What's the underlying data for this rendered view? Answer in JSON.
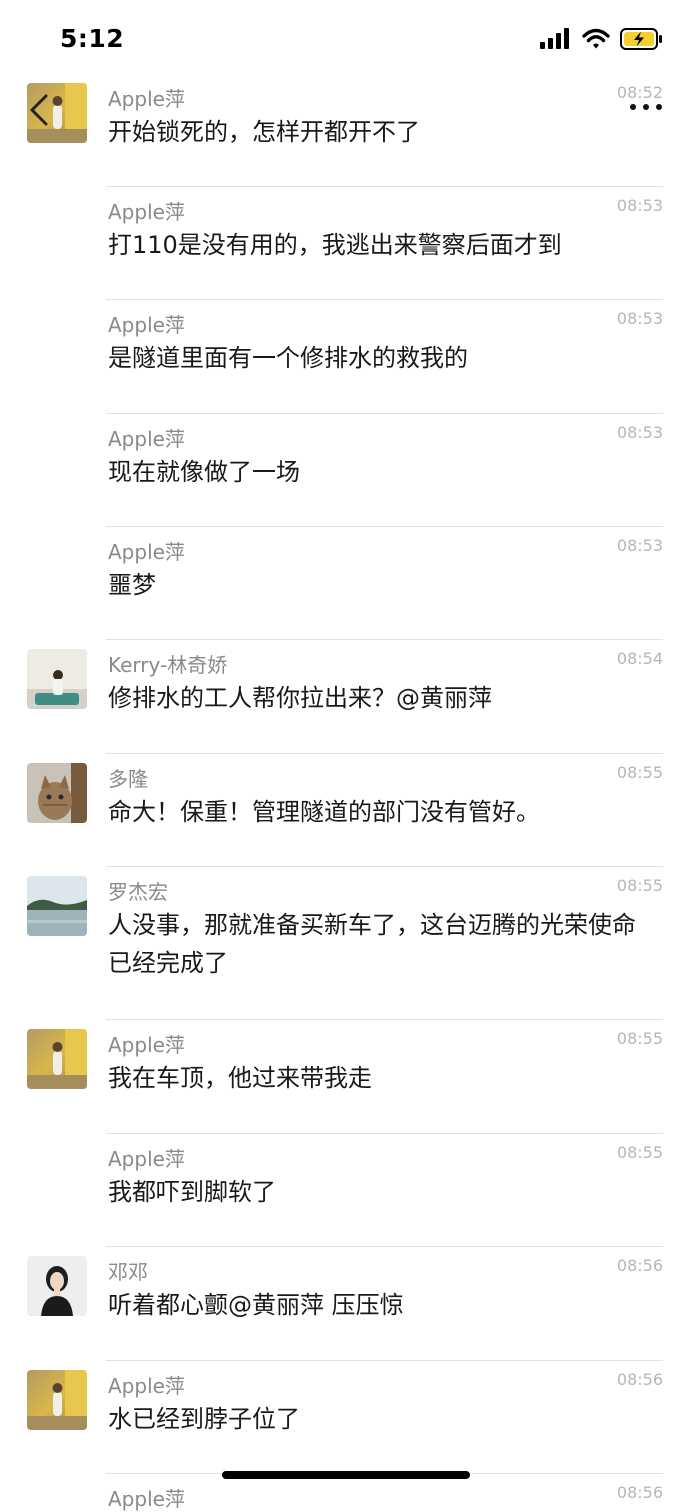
{
  "status_bar": {
    "time": "5:12"
  },
  "messages": [
    {
      "sender": "Apple萍",
      "time": "08:52",
      "text": "开始锁死的，怎样开都开不了",
      "avatar": "avatar-apple"
    },
    {
      "sender": "Apple萍",
      "time": "08:53",
      "text": "打110是没有用的，我逃出来警察后面才到",
      "avatar": ""
    },
    {
      "sender": "Apple萍",
      "time": "08:53",
      "text": "是隧道里面有一个修排水的救我的",
      "avatar": ""
    },
    {
      "sender": "Apple萍",
      "time": "08:53",
      "text": "现在就像做了一场",
      "avatar": ""
    },
    {
      "sender": "Apple萍",
      "time": "08:53",
      "text": "噩梦",
      "avatar": ""
    },
    {
      "sender": "Kerry-林奇娇",
      "time": "08:54",
      "text": "修排水的工人帮你拉出来？@黄丽萍",
      "avatar": "avatar-kerry"
    },
    {
      "sender": "多隆",
      "time": "08:55",
      "text": "命大！保重！管理隧道的部门没有管好。",
      "avatar": "avatar-cat"
    },
    {
      "sender": "罗杰宏",
      "time": "08:55",
      "text": "人没事，那就准备买新车了，这台迈腾的光荣使命已经完成了",
      "avatar": "avatar-lake"
    },
    {
      "sender": "Apple萍",
      "time": "08:55",
      "text": "我在车顶，他过来带我走",
      "avatar": "avatar-apple"
    },
    {
      "sender": "Apple萍",
      "time": "08:55",
      "text": "我都吓到脚软了",
      "avatar": ""
    },
    {
      "sender": "邓邓",
      "time": "08:56",
      "text": "听着都心颤@黄丽萍 压压惊",
      "avatar": "avatar-woman"
    },
    {
      "sender": "Apple萍",
      "time": "08:56",
      "text": "水已经到脖子位了",
      "avatar": "avatar-apple"
    },
    {
      "sender": "Apple萍",
      "time": "08:56",
      "text": "",
      "avatar": ""
    }
  ]
}
